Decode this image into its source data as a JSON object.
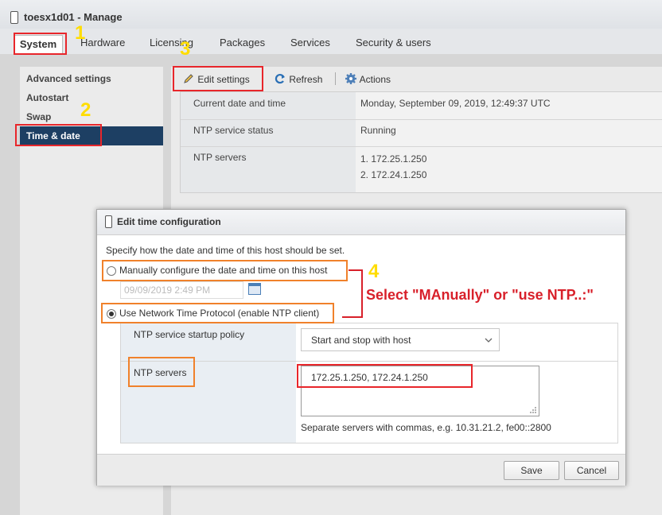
{
  "window": {
    "title": "toesx1d01 - Manage"
  },
  "tabs": [
    "System",
    "Hardware",
    "Licensing",
    "Packages",
    "Services",
    "Security & users"
  ],
  "sidebar": {
    "items": [
      "Advanced settings",
      "Autostart",
      "Swap",
      "Time & date"
    ],
    "selected": "Time & date"
  },
  "toolbar": {
    "edit": "Edit settings",
    "refresh": "Refresh",
    "actions": "Actions"
  },
  "info": {
    "rows": [
      {
        "key": "Current date and time",
        "value": "Monday, September 09, 2019, 12:49:37 UTC"
      },
      {
        "key": "NTP service status",
        "value": "Running"
      },
      {
        "key": "NTP servers",
        "values": [
          "1. 172.25.1.250",
          "2. 172.24.1.250"
        ]
      }
    ]
  },
  "dialog": {
    "title": "Edit time configuration",
    "intro": "Specify how the date and time of this host should be set.",
    "manual_label": "Manually configure the date and time on this host",
    "manual_datetime": "09/09/2019 2:49 PM",
    "ntp_label": "Use Network Time Protocol (enable NTP client)",
    "policy_label": "NTP service startup policy",
    "policy_value": "Start and stop with host",
    "servers_label": "NTP servers",
    "servers_value": "172.25.1.250, 172.24.1.250",
    "servers_hint": "Separate servers with commas, e.g. 10.31.21.2, fe00::2800",
    "save": "Save",
    "cancel": "Cancel",
    "selected_option": "ntp"
  },
  "annotations": {
    "n1": "1",
    "n2": "2",
    "n3": "3",
    "n4": "4",
    "note": "Select \"MAnually\" or \"use NTP..:\"",
    "colors": {
      "red": "#e8262b",
      "orange": "#f0812b",
      "yellow": "#ffdd00"
    }
  }
}
